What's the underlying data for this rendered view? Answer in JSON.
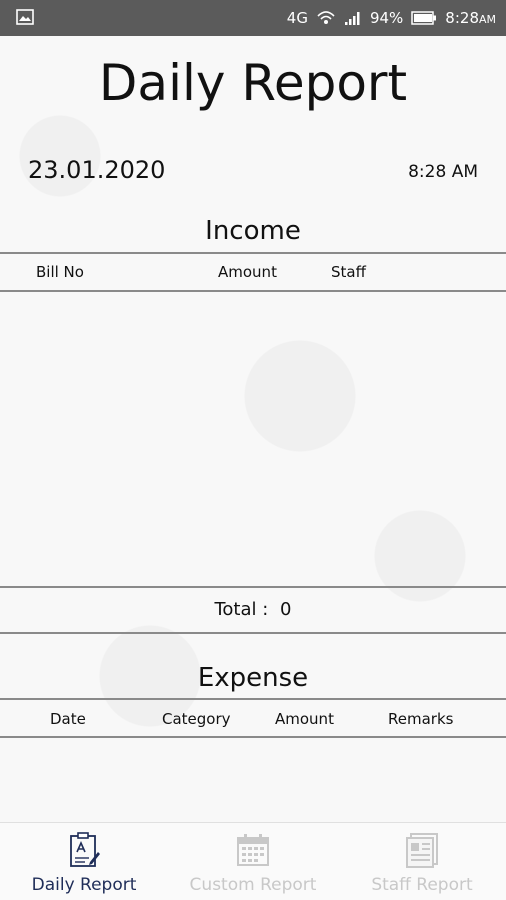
{
  "status_bar": {
    "network": "4G",
    "battery": "94%",
    "time": "8:28",
    "ampm": "AM"
  },
  "page": {
    "title": "Daily Report",
    "date": "23.01.2020",
    "time": "8:28 AM"
  },
  "income": {
    "title": "Income",
    "columns": [
      "Bill No",
      "Amount",
      "Staff"
    ],
    "total_label": "Total :",
    "total_value": "0"
  },
  "expense": {
    "title": "Expense",
    "columns": [
      "Date",
      "Category",
      "Amount",
      "Remarks"
    ]
  },
  "nav": {
    "items": [
      {
        "label": "Daily Report",
        "icon": "daily-report-icon",
        "active": true
      },
      {
        "label": "Custom Report",
        "icon": "calendar-icon",
        "active": false
      },
      {
        "label": "Staff Report",
        "icon": "staff-report-icon",
        "active": false
      }
    ]
  },
  "colors": {
    "status_bar": "#5b5b5b",
    "active_nav": "#1f2d58",
    "inactive_nav": "#c8c8c8"
  }
}
